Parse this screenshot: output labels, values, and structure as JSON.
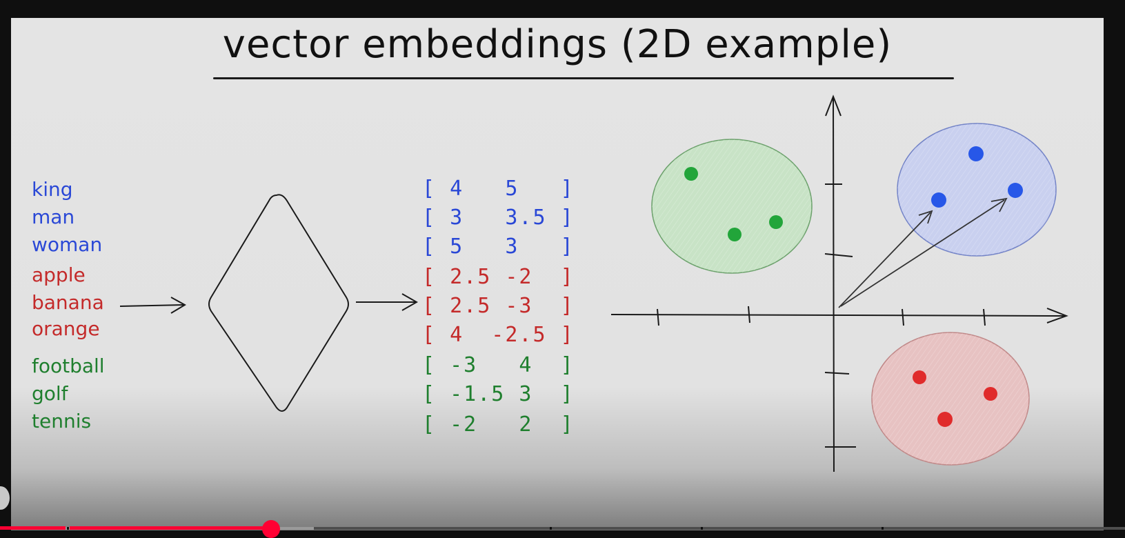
{
  "title": "vector embeddings (2D example)",
  "colors": {
    "blue": "#2a48d6",
    "red": "#c42a2a",
    "green": "#1f7f2e",
    "ink": "#1a1a1a",
    "cluster_green_fill": "#c8e3c6",
    "cluster_blue_fill": "#c9d0ef",
    "cluster_red_fill": "#e7c2c2",
    "progress_red": "#ff0033"
  },
  "words": [
    {
      "label": "king",
      "color": "blue"
    },
    {
      "label": "man",
      "color": "blue"
    },
    {
      "label": "woman",
      "color": "blue"
    },
    {
      "label": "apple",
      "color": "red"
    },
    {
      "label": "banana",
      "color": "red"
    },
    {
      "label": "orange",
      "color": "red"
    },
    {
      "label": "football",
      "color": "green"
    },
    {
      "label": "golf",
      "color": "green"
    },
    {
      "label": "tennis",
      "color": "green"
    }
  ],
  "vectors": [
    {
      "text": "[ 4   5   ]",
      "color": "blue"
    },
    {
      "text": "[ 3   3.5 ]",
      "color": "blue"
    },
    {
      "text": "[ 5   3   ]",
      "color": "blue"
    },
    {
      "text": "[ 2.5 -2  ]",
      "color": "red"
    },
    {
      "text": "[ 2.5 -3  ]",
      "color": "red"
    },
    {
      "text": "[ 4  -2.5 ]",
      "color": "red"
    },
    {
      "text": "[ -3   4  ]",
      "color": "green"
    },
    {
      "text": "[ -1.5 3  ]",
      "color": "green"
    },
    {
      "text": "[ -2   2  ]",
      "color": "green"
    }
  ],
  "model_shape": "diamond",
  "plot": {
    "clusters": [
      "green",
      "blue",
      "red"
    ],
    "points": {
      "green": 3,
      "blue": 3,
      "red": 3
    }
  },
  "video_player": {
    "progress_fraction": 0.235,
    "buffered_fraction": 0.28
  }
}
